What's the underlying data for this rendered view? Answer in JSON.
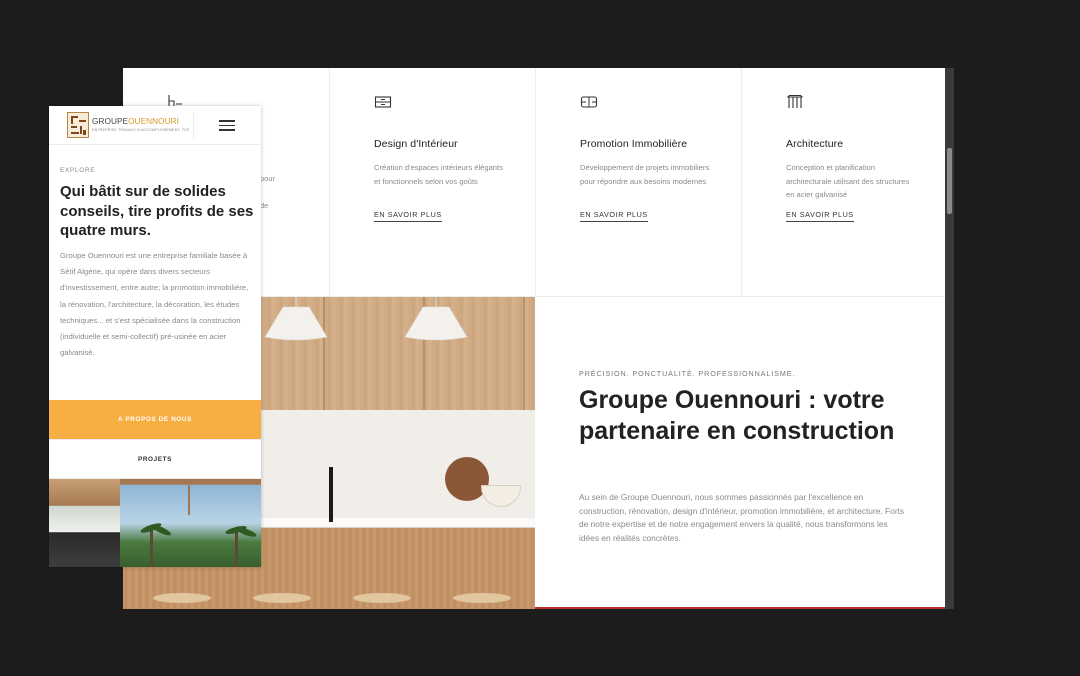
{
  "desktop": {
    "partial_service": {
      "text_lines": [
        "pour",
        "de"
      ]
    },
    "services": [
      {
        "icon": "interior-design-icon",
        "title": "Design d'Intérieur",
        "description": "Création d'espaces intérieurs élégants et fonctionnels selon vos goûts",
        "link": "EN SAVOIR PLUS"
      },
      {
        "icon": "real-estate-icon",
        "title": "Promotion Immobilière",
        "description": "Développement de projets immobiliers pour répondre aux besoins modernes",
        "link": "EN SAVOIR PLUS"
      },
      {
        "icon": "architecture-icon",
        "title": "Architecture",
        "description": "Conception et planification architecturale utilisant des structures en acier galvanisé",
        "link": "EN SAVOIR PLUS"
      }
    ],
    "about": {
      "eyebrow": "PRÉCISION. PONCTUALITÉ. PROFESSIONNALISME.",
      "headline": "Groupe Ouennouri : votre partenaire en construction",
      "body": "Au sein de Groupe Ouennouri, nous sommes passionnés par l'excellence en construction, rénovation, design d'intérieur, promotion immobilière, et architecture. Forts de notre expertise et de notre engagement envers la qualité, nous transformons les idées en réalités concrètes."
    }
  },
  "mobile": {
    "logo": {
      "name_part1": "GROUPE",
      "name_part2": "OUENNOURI",
      "tagline": "ENTREPRISE TRAVAUX D'ACCOMPLISSEMENT, TCE"
    },
    "explore": "EXPLORE",
    "title": "Qui bâtit sur de solides conseils, tire profits de ses quatre murs.",
    "body": "Groupe Ouennouri est une entreprise familiale basée à Sétif Algérie, qui opère dans divers secteurs d'investissement, entre autre; la promotion immobilière, la rénovation, l'architecture, la décoration, les études techniques... et s'est spécialisée dans la construction (individuelle et semi-collectif) pré-usinée en acier galvanisé.",
    "btn_about": "A PROPOS DE NOUS",
    "btn_projects": "PROJETS"
  },
  "colors": {
    "accent": "#f7ae42",
    "brand_gold": "#d8982c",
    "text_dark": "#222222",
    "text_muted": "#8a8a8a",
    "background": "#1c1c1c",
    "red_accent": "#b4302b"
  }
}
